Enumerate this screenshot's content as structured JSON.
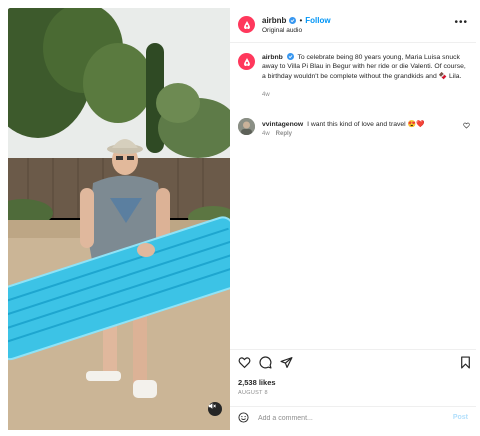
{
  "post": {
    "username": "airbnb",
    "separator": "•",
    "follow_label": "Follow",
    "subtitle": "Original audio",
    "more_label": "•••"
  },
  "caption": {
    "username": "airbnb",
    "text": "To celebrate being 80 years young, Maria Luisa snuck away to Villa Pi Blau in Begur with her ride or die Valenti. Of course, a birthday wouldn't be complete without the grandkids and 🍫 Lila.",
    "time": "4w"
  },
  "comments": [
    {
      "username": "vvintagenow",
      "text": "I want this kind of love and travel 😍❤️",
      "time": "4w",
      "reply_label": "Reply"
    }
  ],
  "stats": {
    "likes": "2,538 likes",
    "date": "AUGUST 8"
  },
  "add_comment": {
    "placeholder": "Add a comment...",
    "post_label": "Post"
  },
  "icons": {
    "brand": "airbnb-logo-icon",
    "verified": "verified-badge-icon",
    "like": "heart-icon",
    "comment": "comment-bubble-icon",
    "share": "paper-plane-icon",
    "save": "bookmark-icon",
    "emoji": "smiley-icon",
    "mute": "speaker-muted-icon"
  },
  "colors": {
    "brand": "#ff385c",
    "link": "#0095f6",
    "muted_text": "#8e8e8e",
    "post_disabled": "#b2dffc",
    "inflatable": "#3cc3e6"
  }
}
